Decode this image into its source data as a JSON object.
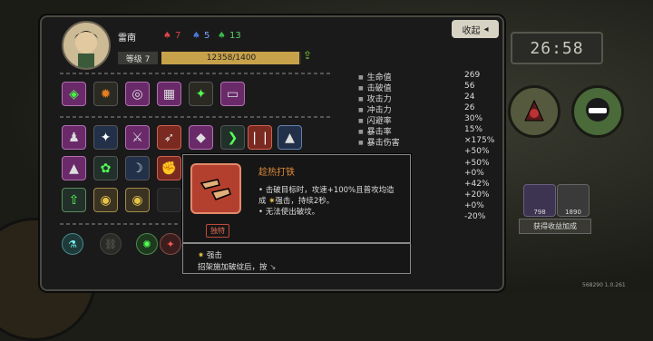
{
  "header": {
    "collapse_label": "收起"
  },
  "player": {
    "name": "雷南",
    "masks": [
      {
        "color": "#d9434a",
        "count": "7"
      },
      {
        "color": "#4a78d9",
        "count": "5"
      },
      {
        "color": "#3ab34a",
        "count": "13"
      }
    ],
    "level_label": "等级 7",
    "xp_text": "12358/1400",
    "xp_fraction": 0.99
  },
  "stats": [
    {
      "label": "生命值",
      "value": "269"
    },
    {
      "label": "击破值",
      "value": "56"
    },
    {
      "label": "攻击力",
      "value": "24"
    },
    {
      "label": "冲击力",
      "value": "26"
    },
    {
      "label": "闪避率",
      "value": "30%"
    },
    {
      "label": "暴击率",
      "value": "15%"
    },
    {
      "label": "暴击伤害",
      "value": "×175%"
    },
    {
      "label": "",
      "value": "+50%"
    },
    {
      "label": "",
      "value": "+50%"
    },
    {
      "label": "",
      "value": "+0%"
    },
    {
      "label": "",
      "value": "+42%"
    },
    {
      "label": "",
      "value": "+20%"
    },
    {
      "label": "",
      "value": "+0%"
    },
    {
      "label": "",
      "value": "-20%"
    }
  ],
  "tooltip": {
    "title": "趁热打铁",
    "line1": "• 击破目标时，攻速+100%且普攻均造",
    "line2": "成",
    "line2_keyword": "强击",
    "line2_rest": "，持续2秒。",
    "line3": "• 无法使出破坟。",
    "tag": "独特"
  },
  "tooltip2": {
    "keyword": "强击",
    "desc": "招架施加破绽后，按"
  },
  "right": {
    "clock": "26:58",
    "card_values": [
      "798",
      "1890"
    ],
    "bonus_label": "获得收益加成"
  },
  "version": "568290 1.0.261",
  "colors": {
    "accent": "#c8a24a",
    "tooltip_title": "#e08a3a",
    "tag": "#c04a3a"
  }
}
